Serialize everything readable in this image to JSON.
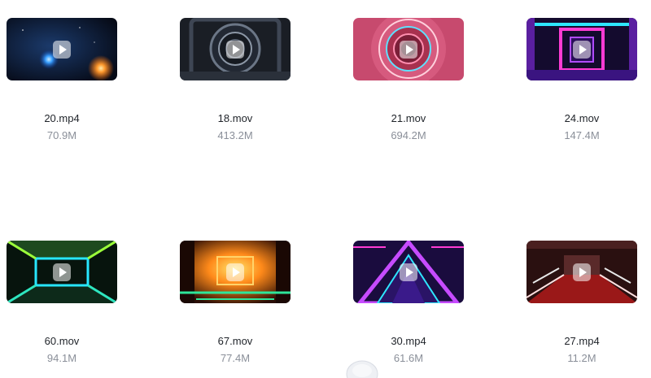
{
  "files": [
    {
      "name": "20.mp4",
      "size": "70.9M",
      "art": "space"
    },
    {
      "name": "18.mov",
      "size": "413.2M",
      "art": "grey-tunnel"
    },
    {
      "name": "21.mov",
      "size": "694.2M",
      "art": "pink-tunnel"
    },
    {
      "name": "24.mov",
      "size": "147.4M",
      "art": "purple-corridor"
    },
    {
      "name": "60.mov",
      "size": "94.1M",
      "art": "green-tunnel"
    },
    {
      "name": "67.mov",
      "size": "77.4M",
      "art": "orange-corridor"
    },
    {
      "name": "30.mp4",
      "size": "61.6M",
      "art": "triangle-tunnel"
    },
    {
      "name": "27.mp4",
      "size": "11.2M",
      "art": "red-corridor"
    }
  ]
}
